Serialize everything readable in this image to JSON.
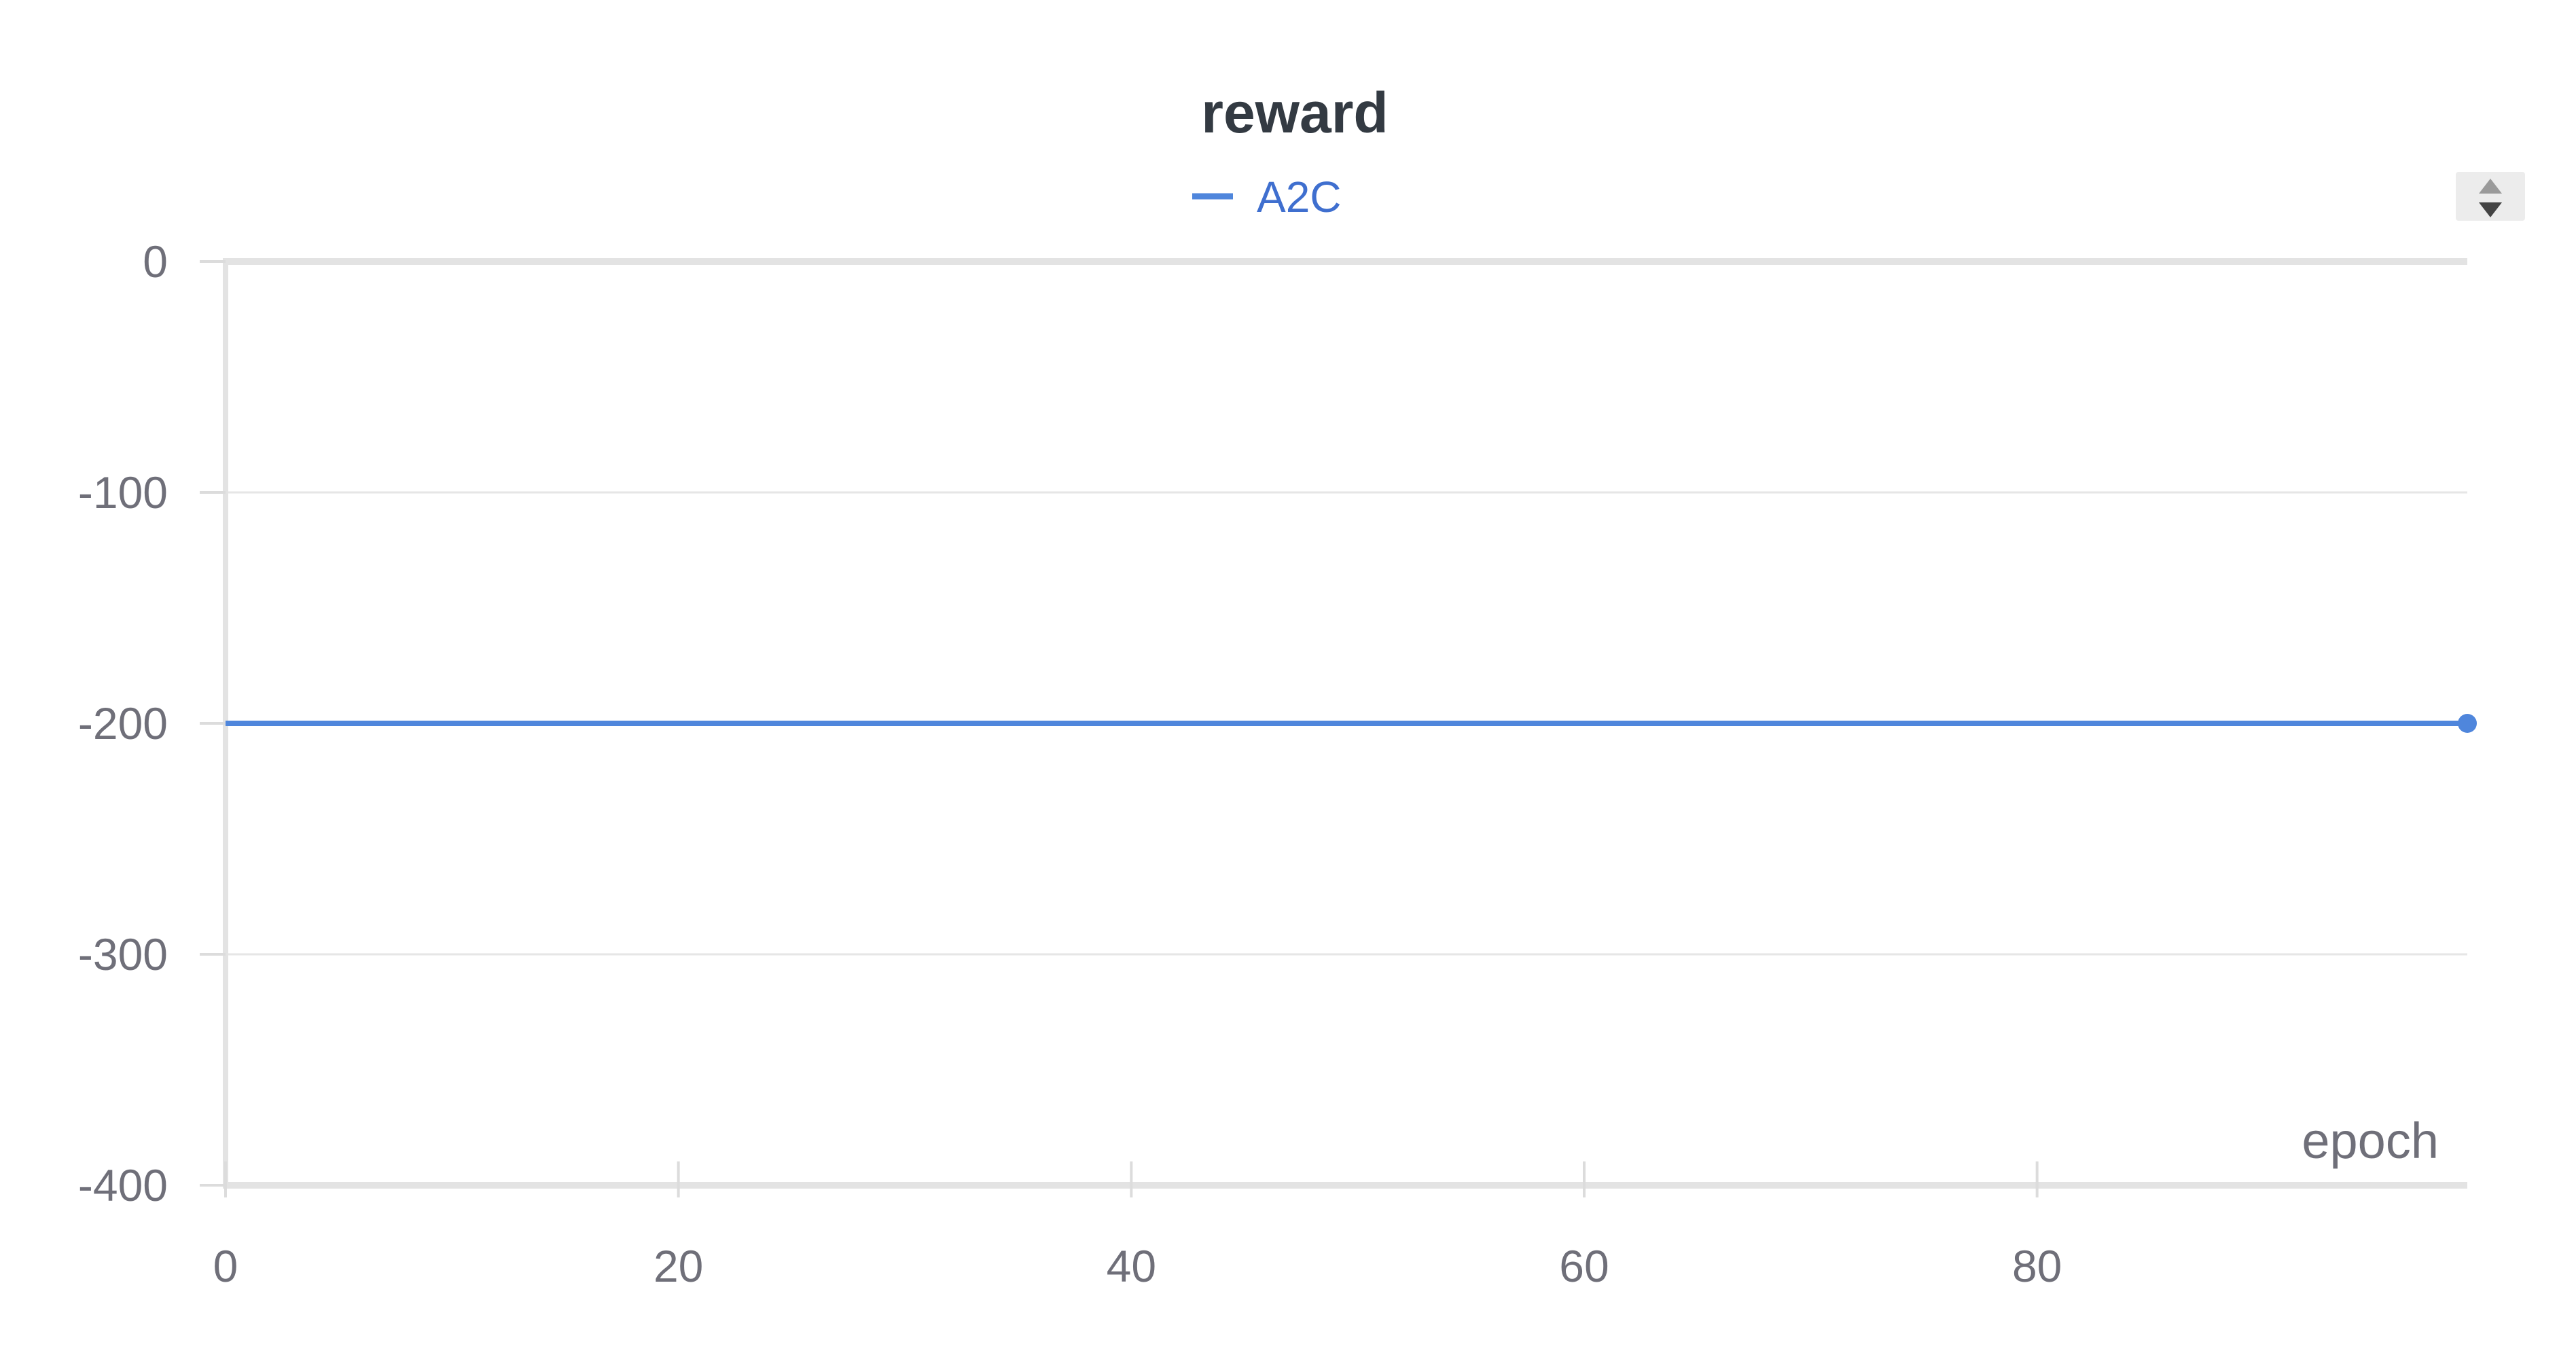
{
  "chart_data": {
    "type": "line",
    "title": "reward",
    "xlabel": "epoch",
    "ylabel": "",
    "xlim": [
      0,
      99
    ],
    "ylim": [
      -400,
      0
    ],
    "x_ticks": [
      0,
      20,
      40,
      60,
      80
    ],
    "y_ticks": [
      0,
      -100,
      -200,
      -300,
      -400
    ],
    "grid": true,
    "legend_position": "top-center",
    "series": [
      {
        "name": "A2C",
        "color": "#4f86dc",
        "x": [
          0,
          99
        ],
        "y": [
          -200,
          -200
        ]
      }
    ]
  },
  "controls": {
    "sort_icon": "sort-updown-icon"
  }
}
